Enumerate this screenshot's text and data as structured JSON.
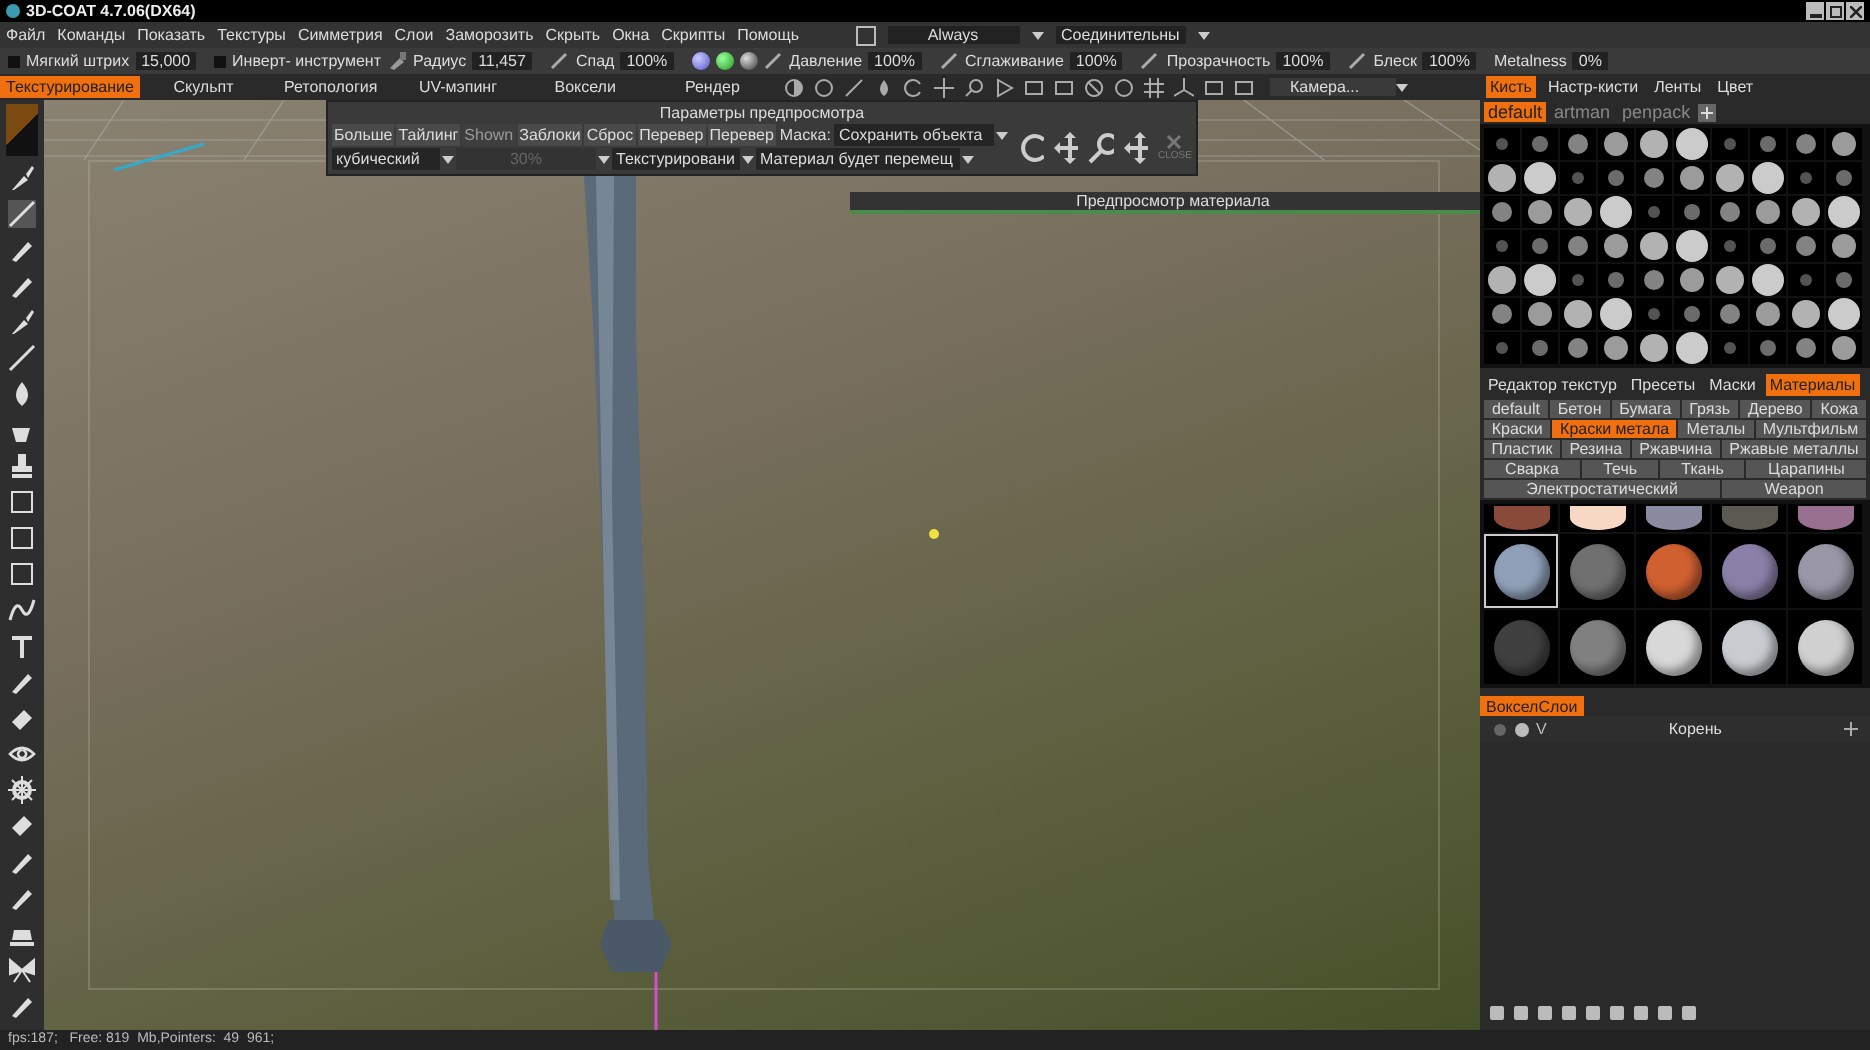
{
  "window": {
    "title": "3D-COAT 4.7.06(DX64)"
  },
  "menu": [
    "Файл",
    "Команды",
    "Показать",
    "Текстуры",
    "Симметрия",
    "Слои",
    "Заморозить",
    "Скрыть",
    "Окна",
    "Скрипты",
    "Помощь"
  ],
  "menu_controls": {
    "checked": false,
    "mode": "Always",
    "connect": "Соединительны"
  },
  "tool_params": [
    {
      "kind": "check",
      "label": "Мягкий штрих",
      "checked": false,
      "value": "15,000"
    },
    {
      "kind": "check",
      "label": "Инверт- инструмент",
      "checked": false
    },
    {
      "kind": "field",
      "label": "Радиус",
      "value": "11,457"
    },
    {
      "kind": "field",
      "label": "Спад",
      "value": "100%"
    },
    {
      "kind": "spheres"
    },
    {
      "kind": "field",
      "label": "Давление",
      "value": "100%"
    },
    {
      "kind": "field",
      "label": "Сглаживание",
      "value": "100%"
    },
    {
      "kind": "field",
      "label": "Прозрачность",
      "value": "100%"
    },
    {
      "kind": "field",
      "label": "Блеск",
      "value": "100%"
    },
    {
      "kind": "field",
      "label": "Metalness",
      "value": "0%"
    }
  ],
  "rooms": [
    {
      "label": "Текстурирование",
      "selected": true
    },
    {
      "label": "Скульпт",
      "selected": false
    },
    {
      "label": "Ретопология",
      "selected": false
    },
    {
      "label": "UV-мэпинг",
      "selected": false
    },
    {
      "label": "Воксели",
      "selected": false
    },
    {
      "label": "Рендер",
      "selected": false
    }
  ],
  "camera": "Камера...",
  "preview_panel": {
    "title": "Параметры предпросмотра",
    "buttons": [
      {
        "label": "Больше",
        "disabled": false
      },
      {
        "label": "Тайлинг",
        "disabled": false
      },
      {
        "label": "Shown",
        "disabled": true
      },
      {
        "label": "Заблоки",
        "disabled": false
      },
      {
        "label": "Сброс",
        "disabled": false
      },
      {
        "label": "Перевер",
        "disabled": false
      },
      {
        "label": "Перевер",
        "disabled": false
      }
    ],
    "mask_label": "Маска:",
    "mask": "Сохранить объекта",
    "projection": "кубический",
    "percent": "30%",
    "mode": "Текстурировани",
    "material_mode": "Материал будет перемещ",
    "close_label": "CLOSE"
  },
  "material_preview": "Предпросмотр материала",
  "brush_tabs": [
    {
      "label": "Кисть",
      "selected": true
    },
    {
      "label": "Настр-кисти",
      "selected": false
    },
    {
      "label": "Ленты",
      "selected": false
    },
    {
      "label": "Цвет",
      "selected": false
    }
  ],
  "brush_sets": [
    {
      "label": "default",
      "selected": true
    },
    {
      "label": "artman",
      "selected": false
    },
    {
      "label": "penpack",
      "selected": false
    }
  ],
  "texture_tabs": [
    {
      "label": "Редактор текстур",
      "selected": false
    },
    {
      "label": "Пресеты",
      "selected": false
    },
    {
      "label": "Маски",
      "selected": false
    },
    {
      "label": "Материалы",
      "selected": true
    }
  ],
  "material_categories": [
    {
      "label": "default",
      "selected": false
    },
    {
      "label": "Бетон",
      "selected": false
    },
    {
      "label": "Бумага",
      "selected": false
    },
    {
      "label": "Грязь",
      "selected": false
    },
    {
      "label": "Дерево",
      "selected": false
    },
    {
      "label": "Кожа",
      "selected": false
    },
    {
      "label": "Краски",
      "selected": false
    },
    {
      "label": "Краски метала",
      "selected": true
    },
    {
      "label": "Металы",
      "selected": false
    },
    {
      "label": "Мультфильм",
      "selected": false
    },
    {
      "label": "Пластик",
      "selected": false
    },
    {
      "label": "Резина",
      "selected": false
    },
    {
      "label": "Ржавчина",
      "selected": false
    },
    {
      "label": "Ржавые металлы",
      "selected": false
    },
    {
      "label": "Сварка",
      "selected": false
    },
    {
      "label": "Течь",
      "selected": false
    },
    {
      "label": "Ткань",
      "selected": false
    },
    {
      "label": "Царапины",
      "selected": false
    },
    {
      "label": "Электростатический",
      "selected": false
    },
    {
      "label": "Weapon",
      "selected": false
    }
  ],
  "materials": [
    {
      "color": "#8a4a3a",
      "selected": false
    },
    {
      "color": "#f6d8c4",
      "selected": false
    },
    {
      "color": "#8a8aa0",
      "selected": false
    },
    {
      "color": "#5a5a50",
      "selected": false
    },
    {
      "color": "#9a7090",
      "selected": false
    },
    {
      "color": "#8fa0b8",
      "selected": true
    },
    {
      "color": "#707070",
      "selected": false
    },
    {
      "color": "#d06030",
      "selected": false
    },
    {
      "color": "#8a80a8",
      "selected": false
    },
    {
      "color": "#9a98a8",
      "selected": false
    },
    {
      "color": "#404040",
      "selected": false
    },
    {
      "color": "#808080",
      "selected": false
    },
    {
      "color": "#d8d8d8",
      "selected": false
    },
    {
      "color": "#c8ccd0",
      "selected": false
    },
    {
      "color": "#d0d0d0",
      "selected": false
    }
  ],
  "layers_tab": "ВокселСлои",
  "layer": {
    "visibility": "V",
    "name": "Корень"
  },
  "status_bar": "fps:187;   Free: 819  Mb,Pointers:  49  961;"
}
